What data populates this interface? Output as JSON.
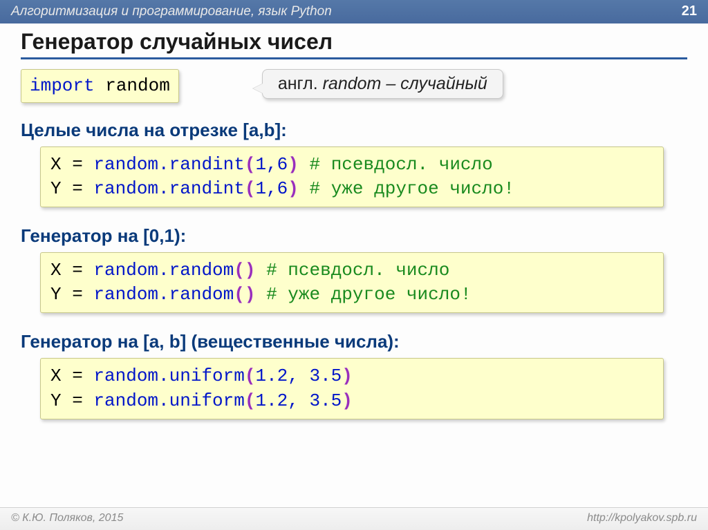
{
  "header": {
    "course": "Алгоритмизация и программирование, язык Python",
    "page": "21"
  },
  "title": "Генератор случайных чисел",
  "import_line": {
    "kw": "import",
    "mod": " random"
  },
  "callout": {
    "prefix": "англ. ",
    "word": "random",
    "suffix": " – случайный"
  },
  "sec1": {
    "label": "Целые числа на отрезке [a,b]:",
    "l1": {
      "v": "X",
      "eq": " = ",
      "call": "random.randint",
      "args": "1,6",
      "c": "# псевдосл. число"
    },
    "l2": {
      "v": "Y",
      "eq": " = ",
      "call": "random.randint",
      "args": "1,6",
      "c": "# уже другое число!"
    }
  },
  "sec2": {
    "label": "Генератор на [0,1):",
    "l1": {
      "v": "X",
      "eq": " = ",
      "call": "random.random",
      "args": "",
      "pad": "   ",
      "c": "# псевдосл. число"
    },
    "l2": {
      "v": "Y",
      "eq": " = ",
      "call": "random.random",
      "args": "",
      "pad": "   ",
      "c": "# уже другое число!"
    }
  },
  "sec3": {
    "label": "Генератор на [a, b] (вещественные числа):",
    "l1": {
      "v": "X",
      "eq": " = ",
      "call": "random.uniform",
      "args": "1.2, 3.5"
    },
    "l2": {
      "v": "Y",
      "eq": " = ",
      "call": "random.uniform",
      "args": "1.2, 3.5"
    }
  },
  "footer": {
    "copyright": "© К.Ю. Поляков, 2015",
    "url": "http://kpolyakov.spb.ru"
  }
}
